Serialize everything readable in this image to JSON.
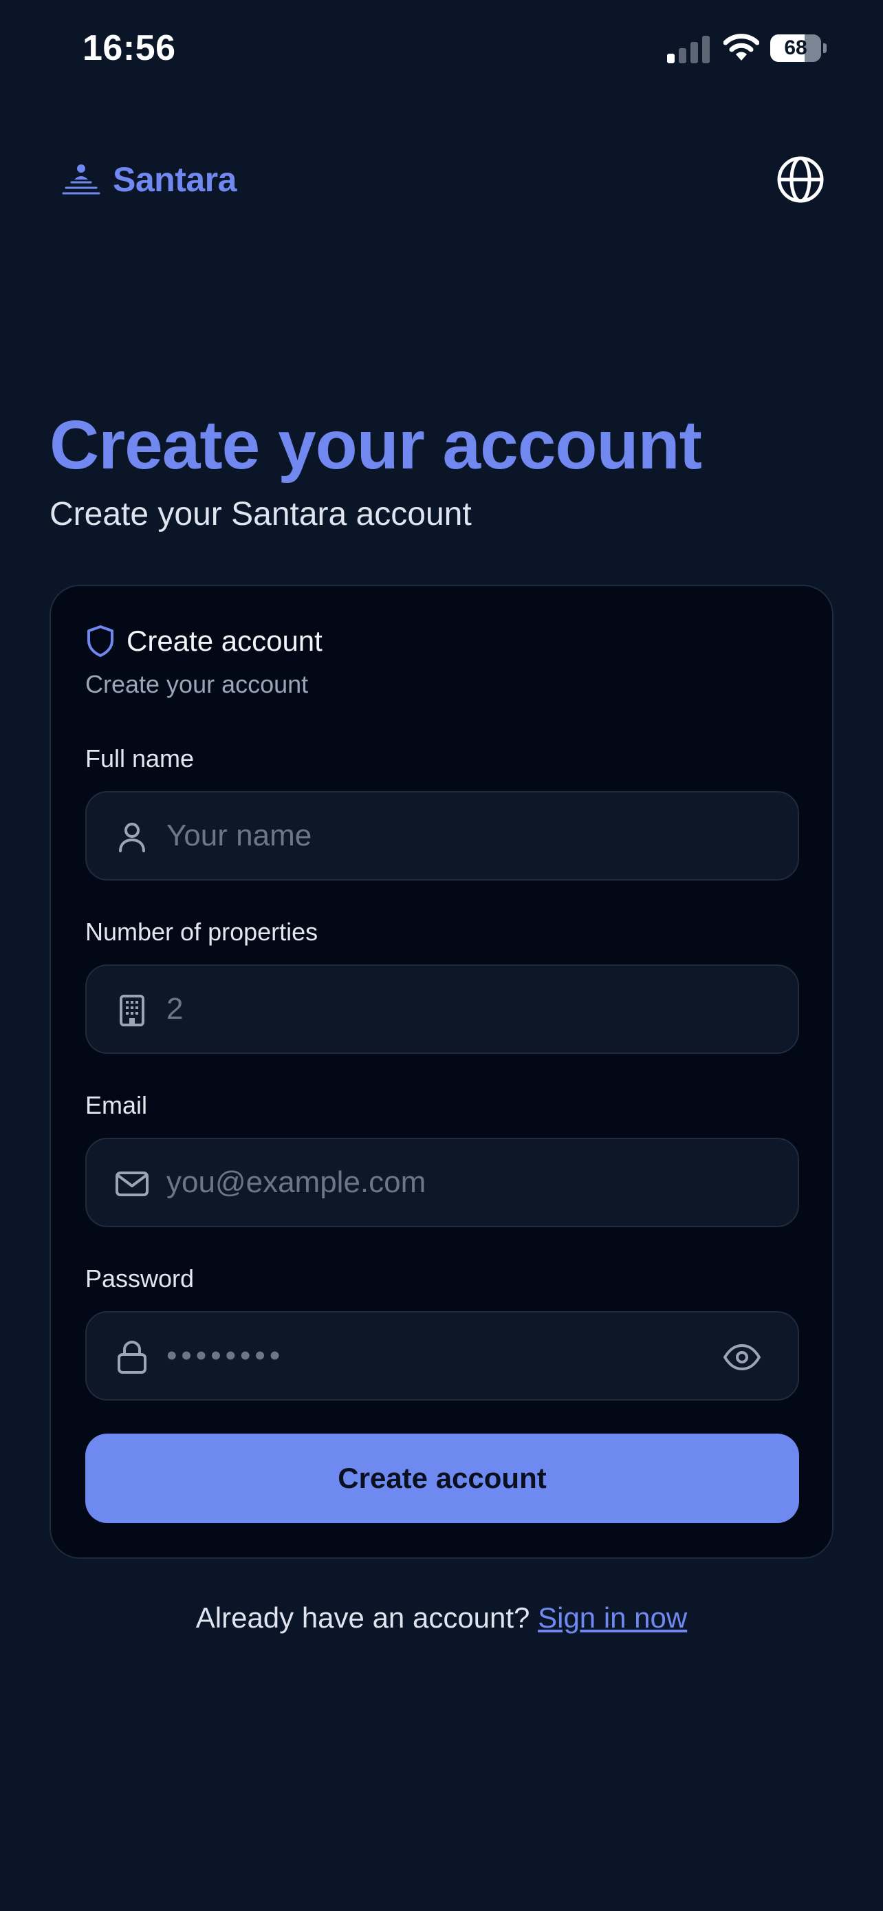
{
  "status_bar": {
    "time": "16:56",
    "battery_level": "68",
    "battery_fraction": 0.68,
    "signal_bars_active": 1,
    "signal_bars_total": 4
  },
  "header": {
    "brand_name": "Santara",
    "brand_icon": "user-stack-icon",
    "language_icon": "globe-icon"
  },
  "page": {
    "title": "Create your account",
    "subtitle": "Create your Santara account"
  },
  "card": {
    "icon": "shield-icon",
    "title": "Create account",
    "subtitle": "Create your account",
    "fields": {
      "full_name": {
        "label": "Full name",
        "placeholder": "Your name",
        "value": "",
        "icon": "user-icon"
      },
      "properties": {
        "label": "Number of properties",
        "placeholder": "2",
        "value": "",
        "icon": "building-icon"
      },
      "email": {
        "label": "Email",
        "placeholder": "you@example.com",
        "value": "",
        "icon": "mail-icon"
      },
      "password": {
        "label": "Password",
        "placeholder": "••••••••",
        "value": "",
        "icon": "lock-icon",
        "toggle_icon": "eye-icon"
      }
    },
    "submit_label": "Create account"
  },
  "footer": {
    "prompt": "Already have an account?",
    "link_label": "Sign in now"
  },
  "colors": {
    "background": "#0a1628",
    "card": "#030817",
    "accent": "#7088f0",
    "button": "#6e8af0"
  }
}
